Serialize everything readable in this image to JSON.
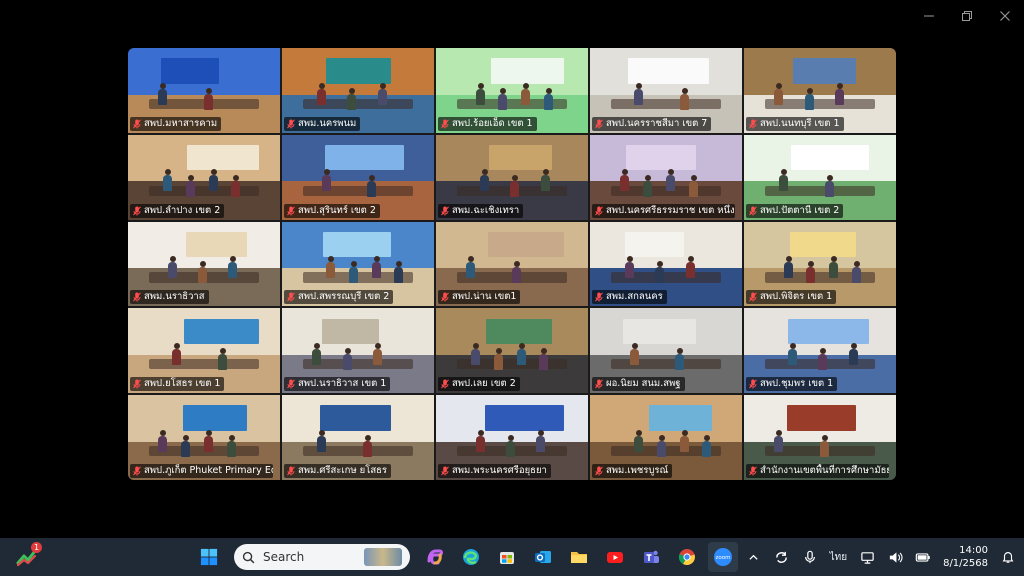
{
  "window": {
    "controls": {
      "minimize": "—",
      "restore": "❐",
      "close": "✕"
    }
  },
  "tiles": [
    {
      "label": "สพป.มหาสารคาม",
      "wall": "#3a6fd1",
      "floor": "#b88a5a",
      "board": "#1e4fb8"
    },
    {
      "label": "สพม.นครพนม",
      "wall": "#c47a3a",
      "floor": "#3e6e9c",
      "board": "#2a8c8a"
    },
    {
      "label": "สพป.ร้อยเอ็ด เขต 1",
      "wall": "#b7e8b0",
      "floor": "#7fd48c",
      "board": "#eef7ee",
      "active": true
    },
    {
      "label": "สพป.นครราชสีมา เขต 7",
      "wall": "#e2e0da",
      "floor": "#c7c2b7",
      "board": "#fafafa"
    },
    {
      "label": "สพป.นนทบุรี เขต 1",
      "wall": "#9c7a4c",
      "floor": "#e7e2d7",
      "board": "#5a7db0"
    },
    {
      "label": "สพป.ลำปาง เขต 2",
      "wall": "#d7b487",
      "floor": "#5a4436",
      "board": "#f0e6d0"
    },
    {
      "label": "สพป.สุรินทร์ เขต 2",
      "wall": "#3f5f9a",
      "floor": "#a8643e",
      "board": "#7fb2e8"
    },
    {
      "label": "สพม.ฉะเชิงเทรา",
      "wall": "#a8875c",
      "floor": "#3a3a46",
      "board": "#c9a46a"
    },
    {
      "label": "สพป.นครศรีธรรมราช เขต หนึ่ง",
      "wall": "#c7b9d8",
      "floor": "#6a4a3c",
      "board": "#e0d2ea"
    },
    {
      "label": "สพป.ปัตตานี เขต 2",
      "wall": "#e9f3e6",
      "floor": "#6fb070",
      "board": "#ffffff"
    },
    {
      "label": "สพม.นราธิวาส",
      "wall": "#f1ede6",
      "floor": "#7a6a58",
      "board": "#e8d8b8"
    },
    {
      "label": "สพป.สพรรณบุรี เขต 2",
      "wall": "#4a86c9",
      "floor": "#d7c4a1",
      "board": "#9cd0f0"
    },
    {
      "label": "สพป.น่าน เขต1",
      "wall": "#d2b890",
      "floor": "#8a6a4e",
      "board": "#c8a98a"
    },
    {
      "label": "สพม.สกลนคร",
      "wall": "#ebe7df",
      "floor": "#2f4f86",
      "board": "#f5f3ee"
    },
    {
      "label": "สพป.พิจิตร เขต 1",
      "wall": "#d6c6a0",
      "floor": "#b89a6a",
      "board": "#f0d98a"
    },
    {
      "label": "สพป.ยโสธร เขต 1",
      "wall": "#e9dcc6",
      "floor": "#c9a77e",
      "board": "#3b8bc8"
    },
    {
      "label": "สพป.นราธิวาส เขต 1",
      "wall": "#eae5da",
      "floor": "#7b7a88",
      "board": "#c0b7a4"
    },
    {
      "label": "สพป.เลย เขต 2",
      "wall": "#a88a5c",
      "floor": "#3c3a3a",
      "board": "#4e8a5e"
    },
    {
      "label": "ผอ.นิยม สนม.สพฐ",
      "wall": "#d9d7d3",
      "floor": "#6b6b6b",
      "board": "#e8e6e2"
    },
    {
      "label": "สพป.ชุมพร เขต 1",
      "wall": "#e6e3de",
      "floor": "#4a6da6",
      "board": "#8bb8e8"
    },
    {
      "label": "สพป.ภูเก็ต Phuket Primary Ed...",
      "wall": "#d9c3a0",
      "floor": "#8a6a4a",
      "board": "#2d7cc4"
    },
    {
      "label": "สพม.ศรีสะเกษ ยโสธร",
      "wall": "#ede5d5",
      "floor": "#8c7a60",
      "board": "#2d5a9a"
    },
    {
      "label": "สพม.พระนครศรีอยุธยา",
      "wall": "#e4e7ee",
      "floor": "#5a4a46",
      "board": "#2f5ab8"
    },
    {
      "label": "สพม.เพชรบูรณ์",
      "wall": "#d0a878",
      "floor": "#7a5a3a",
      "board": "#6fb2d8"
    },
    {
      "label": "สำนักงานเขตพื้นที่การศึกษามัธยมศึก...",
      "wall": "#eeebe4",
      "floor": "#4a5a4a",
      "board": "#9a3c2a"
    }
  ],
  "taskbar": {
    "widget_badge": "1",
    "search_placeholder": "Search",
    "apps": [
      "start-icon",
      "copilot-icon",
      "edge-icon",
      "store-icon",
      "outlook-icon",
      "file-explorer-icon",
      "youtube-icon",
      "teams-icon",
      "chrome-icon",
      "zoom-icon"
    ],
    "language": "ไทย",
    "time": "14:00",
    "date": "8/1/2568",
    "zoom_label": "zoom"
  }
}
